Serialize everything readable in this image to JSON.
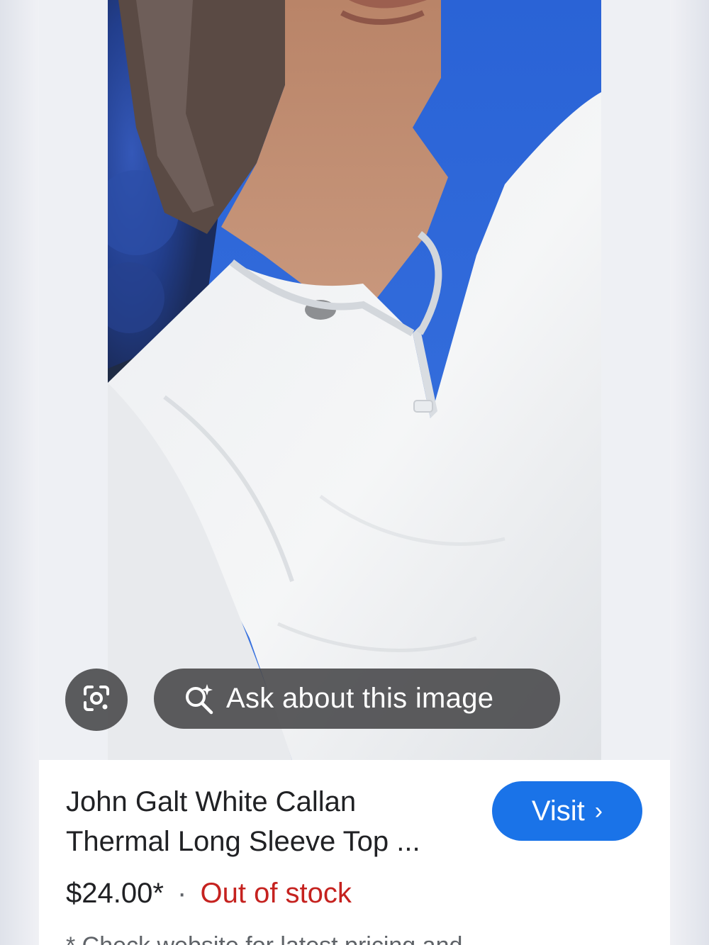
{
  "image_overlay": {
    "lens_button_icon": "google-lens-icon",
    "ask_icon": "magnify-sparkle-icon",
    "ask_label": "Ask about this image"
  },
  "product": {
    "title_line1": "John Galt White Callan",
    "title_line2": "Thermal Long Sleeve Top ...",
    "price": "$24.00*",
    "separator": "·",
    "stock_status": "Out of stock",
    "disclaimer_partial": "* Check website for latest pricing and"
  },
  "visit_button": {
    "label": "Visit",
    "chevron": "›"
  },
  "colors": {
    "accent_blue": "#1a73e8",
    "out_of_stock_red": "#c5221f",
    "overlay_gray": "#464648"
  }
}
